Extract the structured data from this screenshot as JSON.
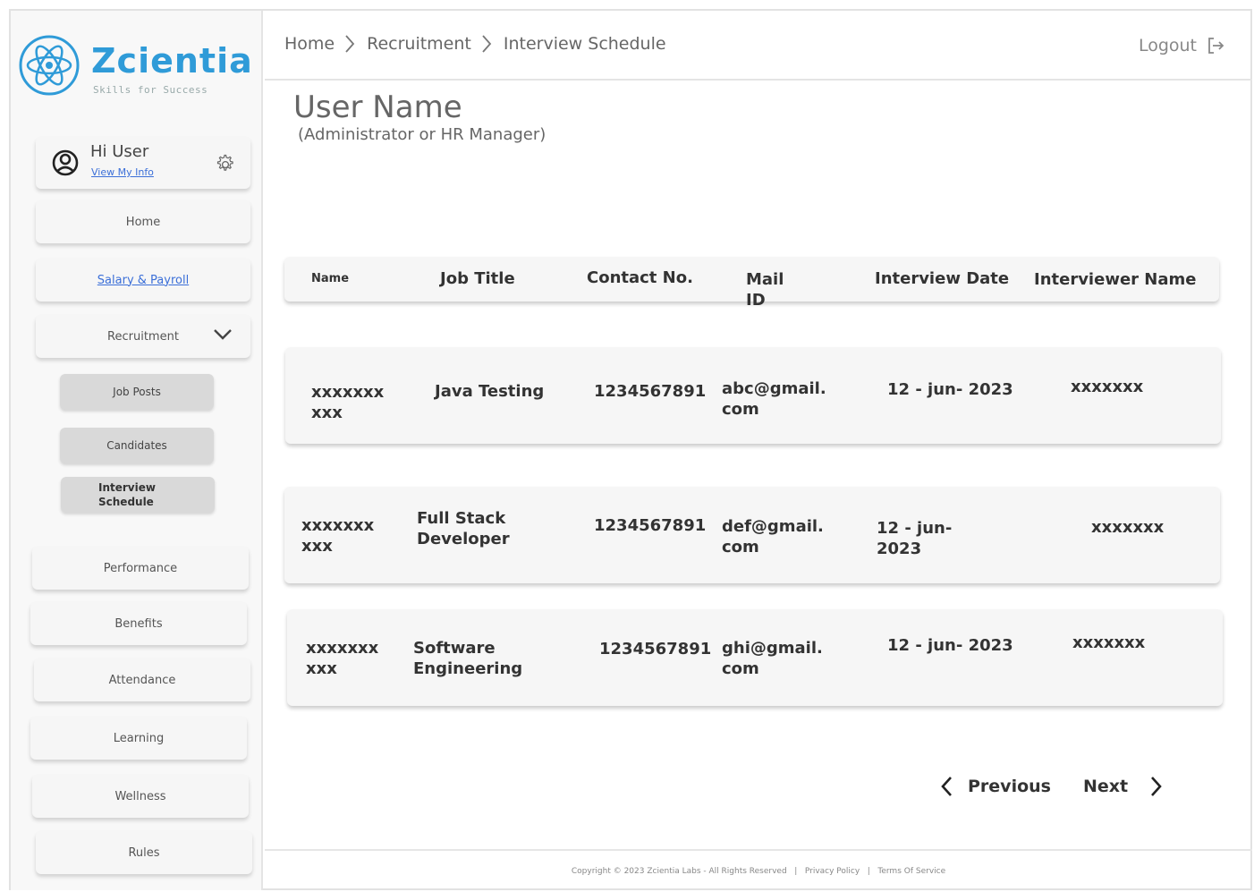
{
  "brand": {
    "name": "Zcientia",
    "tagline": "Skills for Success"
  },
  "user": {
    "greeting": "Hi User",
    "view_info": "View My Info"
  },
  "sidebar": {
    "items": [
      {
        "label": "Home"
      },
      {
        "label": "Salary & Payroll"
      },
      {
        "label": "Recruitment"
      },
      {
        "label": "Performance"
      },
      {
        "label": "Benefits"
      },
      {
        "label": "Attendance"
      },
      {
        "label": "Learning"
      },
      {
        "label": "Wellness"
      },
      {
        "label": "Rules"
      }
    ],
    "recruitment_sub": [
      {
        "label": "Job Posts"
      },
      {
        "label": "Candidates"
      },
      {
        "label": "Interview Schedule"
      }
    ]
  },
  "breadcrumb": [
    "Home",
    "Recruitment",
    "Interview Schedule"
  ],
  "header": {
    "logout": "Logout"
  },
  "page": {
    "title": "User Name",
    "subtitle": "(Administrator or HR Manager)"
  },
  "table": {
    "columns": [
      "Name",
      "Job  Title",
      "Contact No.",
      "Mail ID",
      "Interview Date",
      "Interviewer Name"
    ],
    "rows": [
      {
        "name": "xxxxxxx xxx",
        "job_title": "Java Testing",
        "contact": "1234567891",
        "mail": "abc@gmail. com",
        "date": "12 - jun- 2023",
        "interviewer": "xxxxxxx"
      },
      {
        "name": "xxxxxxx xxx",
        "job_title": "Full Stack Developer",
        "contact": "1234567891",
        "mail": "def@gmail. com",
        "date": "12 - jun- 2023",
        "interviewer": "xxxxxxx"
      },
      {
        "name": "xxxxxxx xxx",
        "job_title": "Software Engineering",
        "contact": "1234567891",
        "mail": "ghi@gmail. com",
        "date": "12 - jun- 2023",
        "interviewer": "xxxxxxx"
      }
    ]
  },
  "pagination": {
    "previous": "Previous",
    "next": "Next"
  },
  "footer": {
    "text": "Copyright © 2023 Zcientia Labs - All Rights Reserved   |   Privacy Policy   |   Terms Of Service"
  },
  "colors": {
    "brand": "#2f9bd8",
    "link": "#3b6fd8",
    "card": "#f6f6f6",
    "subitem": "#d9d9d9"
  },
  "icons": [
    "atom-logo-icon",
    "user-avatar-icon",
    "gear-icon",
    "chevron-down-icon",
    "chevron-right-icon",
    "logout-icon",
    "chevron-left-icon"
  ]
}
